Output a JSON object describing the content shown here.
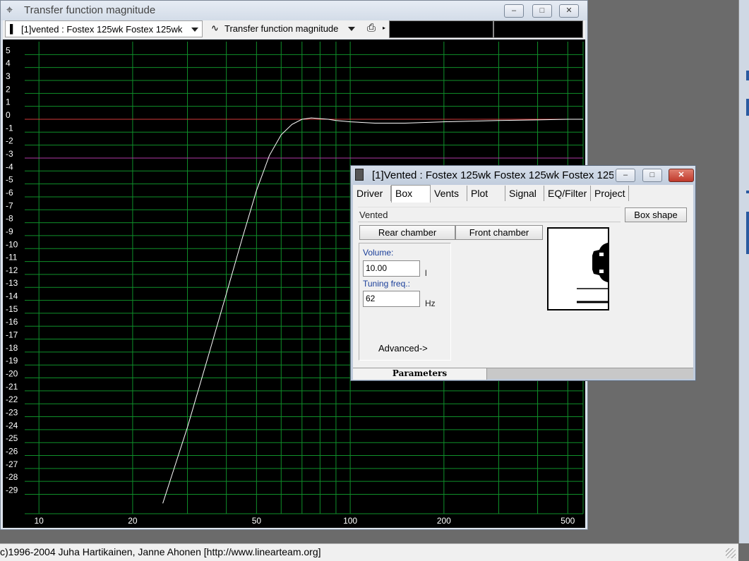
{
  "main_window": {
    "title": "Transfer function magnitude",
    "minimize_label": "–",
    "maximize_label": "□",
    "close_label": "✕"
  },
  "toolbar": {
    "curve_selector_label": "[1]vented : Fostex 125wk Fostex 125wk",
    "graph_type_label": "Transfer function magnitude"
  },
  "graph": {
    "y_ticks": [
      "5",
      "4",
      "3",
      "2",
      "1",
      "0",
      "-1",
      "-2",
      "-3",
      "-4",
      "-5",
      "-6",
      "-7",
      "-8",
      "-9",
      "-10",
      "-11",
      "-12",
      "-13",
      "-14",
      "-15",
      "-16",
      "-17",
      "-18",
      "-19",
      "-20",
      "-21",
      "-22",
      "-23",
      "-24",
      "-25",
      "-26",
      "-27",
      "-28",
      "-29"
    ],
    "x_ticks": [
      "10",
      "20",
      "50",
      "100",
      "200",
      "500"
    ],
    "colors": {
      "background": "#000000",
      "grid": "#0f8f2a",
      "axis_labels": "#ffffff",
      "reference_0db": "#d23a3a",
      "reference_minus3db": "#b03aa6",
      "response": "#ffffff"
    }
  },
  "chart_data": {
    "type": "line",
    "title": "Transfer function magnitude",
    "x_scale": "log",
    "xlim": [
      9,
      560
    ],
    "ylim": [
      -30.5,
      6
    ],
    "grid": true,
    "reference_lines": [
      0,
      -3
    ],
    "series": [
      {
        "x": [
          25,
          30,
          35,
          40,
          45,
          50,
          55,
          60,
          65,
          70,
          75,
          80,
          85,
          90,
          100,
          120,
          150,
          200,
          300,
          400,
          500,
          560
        ],
        "y": [
          -29.7,
          -23.8,
          -18.3,
          -13.5,
          -9.2,
          -5.5,
          -2.8,
          -1.2,
          -0.4,
          0.0,
          0.1,
          0.05,
          0.0,
          -0.1,
          -0.2,
          -0.3,
          -0.3,
          -0.2,
          -0.1,
          -0.05,
          0.0,
          0.0
        ]
      }
    ]
  },
  "status_bar": {
    "text": "c)1996-2004 Juha Hartikainen, Janne Ahonen [http://www.linearteam.org]"
  },
  "param_window": {
    "title": "[1]Vented : Fostex 125wk Fostex 125wk Fostex 125...",
    "tabs": [
      "Driver",
      "Box",
      "Vents",
      "Plot",
      "Signal",
      "EQ/Filter",
      "Project"
    ],
    "active_tab": "Box",
    "box_type": "Vented",
    "box_shape_button": "Box shape",
    "rear_chamber_button": "Rear chamber",
    "front_chamber_button": "Front chamber",
    "volume_label": "Volume:",
    "volume_value": "10.00",
    "volume_unit": "l",
    "tuning_label": "Tuning freq.:",
    "tuning_value": "62",
    "tuning_unit": "Hz",
    "advanced_link": "Advanced->",
    "footer_tab": "Parameters"
  }
}
